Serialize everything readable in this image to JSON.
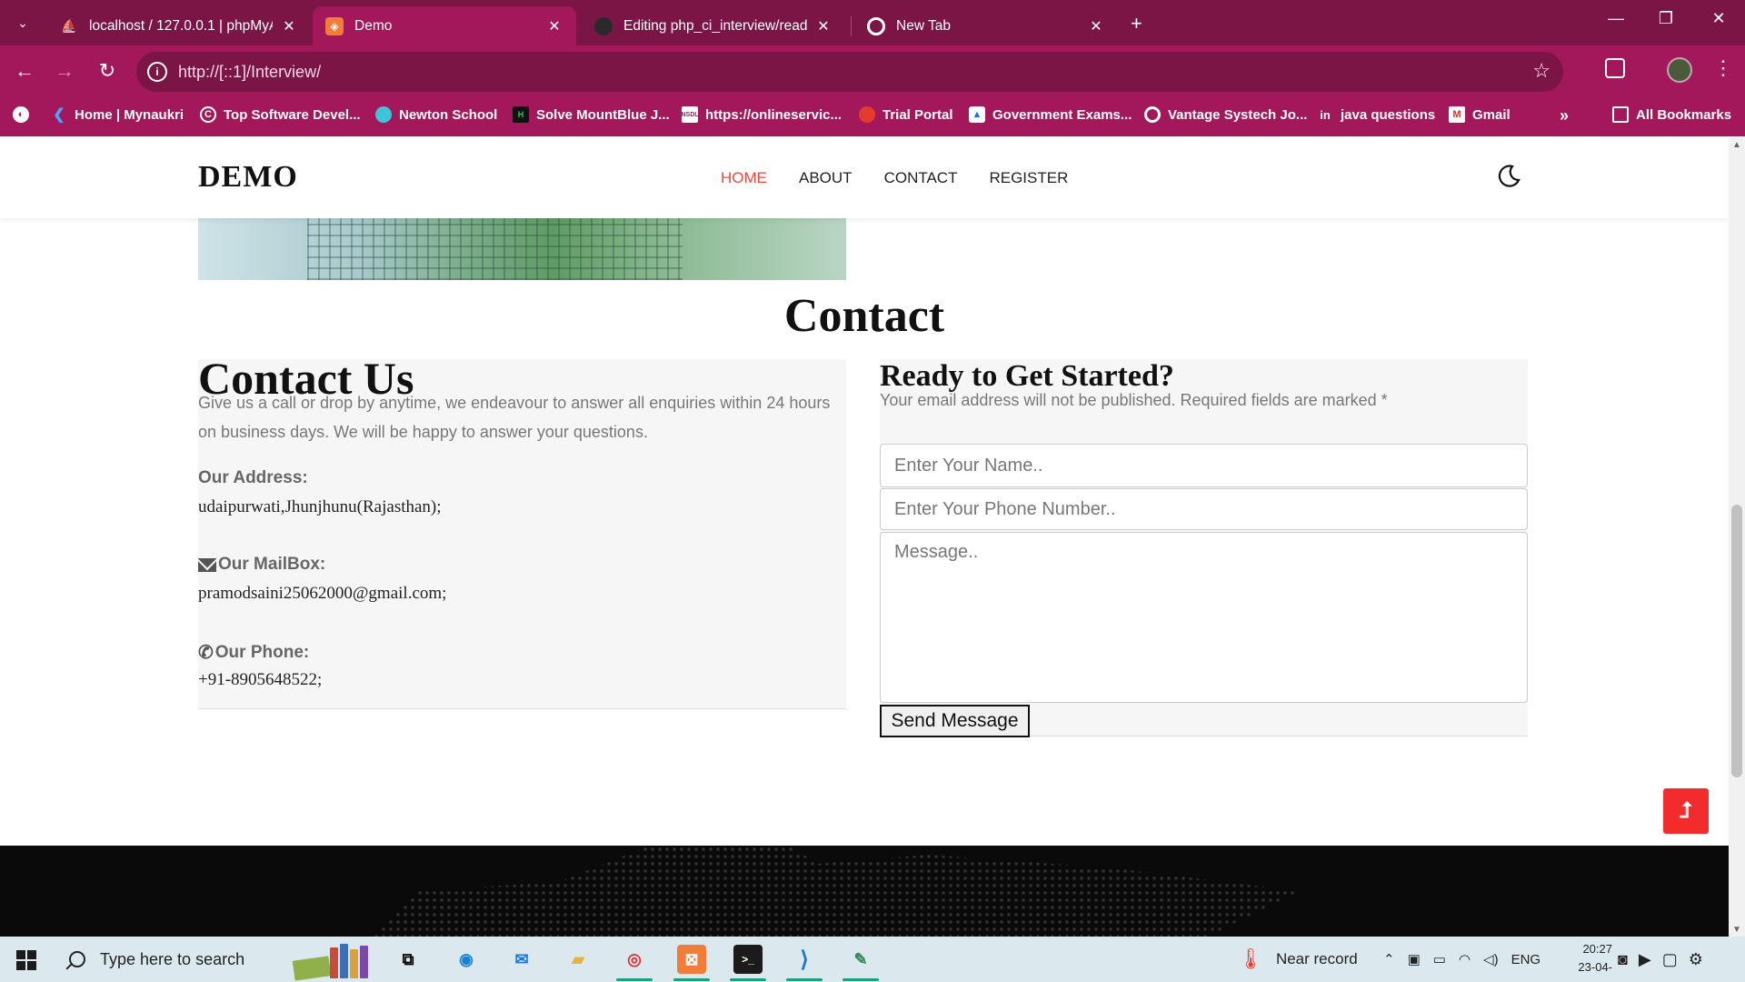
{
  "browser": {
    "tabs": [
      {
        "title": "localhost / 127.0.0.1 | phpMyAdmin",
        "active": false
      },
      {
        "title": "Demo",
        "active": true
      },
      {
        "title": "Editing php_ci_interview/readme",
        "active": false
      },
      {
        "title": "New Tab",
        "active": false
      }
    ],
    "url": "http://[::1]/Interview/",
    "bookmarks": [
      "Home | Mynaukri",
      "Top Software Devel...",
      "Newton School",
      "Solve MountBlue J...",
      "https://onlineservic...",
      "Trial Portal",
      "Government Exams...",
      "Vantage Systech Jo...",
      "java questions",
      "Gmail"
    ],
    "all_bookmarks": "All Bookmarks",
    "more_bookmarks": "»"
  },
  "site": {
    "logo": "DEMO",
    "nav": [
      {
        "label": "HOME",
        "active": true
      },
      {
        "label": "ABOUT",
        "active": false
      },
      {
        "label": "CONTACT",
        "active": false
      },
      {
        "label": "REGISTER",
        "active": false
      }
    ],
    "accent_color": "#e84a3c"
  },
  "contact": {
    "section_title": "Contact",
    "left": {
      "heading": "Contact Us",
      "intro": "Give us a call or drop by anytime, we endeavour to answer all enquiries within 24 hours on business days. We will be happy to answer your questions.",
      "address_label": "Our Address:",
      "address": "udaipurwati,Jhunjhunu(Rajasthan);",
      "mail_label": "Our MailBox:",
      "mail": "pramodsaini25062000@gmail.com;",
      "phone_label": "Our Phone:",
      "phone": "+91-8905648522;"
    },
    "form": {
      "heading": "Ready to Get Started?",
      "note": "Your email address will not be published. Required fields are marked *",
      "name_placeholder": "Enter Your Name..",
      "phone_placeholder": "Enter Your Phone Number..",
      "message_placeholder": "Message..",
      "submit": "Send Message"
    }
  },
  "back_to_top": "⮥",
  "taskbar": {
    "search_placeholder": "Type here to search",
    "weather": "Near record",
    "language": "ENG",
    "time": "20:27",
    "date": "23-04-"
  }
}
